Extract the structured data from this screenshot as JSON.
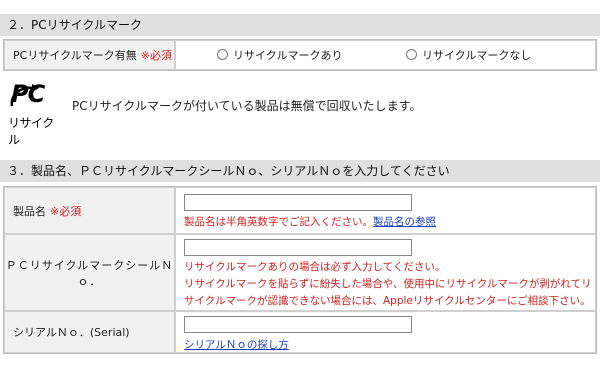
{
  "section2": {
    "title": "２．PCリサイクルマーク"
  },
  "recycle_row": {
    "label": "PCリサイクルマーク有無",
    "required": "※必須",
    "options": [
      "リサイクルマークあり",
      "リサイクルマークなし"
    ]
  },
  "logo": {
    "mark": "PC",
    "text": "リサイクル",
    "note": "PCリサイクルマークが付いている製品は無償で回収いたします。"
  },
  "section3": {
    "title": "３．製品名、ＰＣリサイクルマークシールＮｏ、シリアルＮｏを入力してください"
  },
  "product_row": {
    "label": "製品名",
    "required": "※必須",
    "value": "",
    "note": "製品名は半角英数字でご記入ください。",
    "link": "製品名の参照"
  },
  "seal_row": {
    "label": "ＰＣリサイクルマークシールＮｏ．",
    "value": "",
    "notes": [
      "リサイクルマークありの場合は必ず入力してください。",
      "リサイクルマークを貼らずに紛失した場合や、使用中にリサイクルマークが剥がれてリ",
      "サイクルマークが認識できない場合には、Appleリサイクルセンターにご相談下さい。"
    ]
  },
  "serial_row": {
    "label": "シリアルＮｏ．(Serial)",
    "value": "",
    "link": "シリアルＮｏの探し方"
  }
}
